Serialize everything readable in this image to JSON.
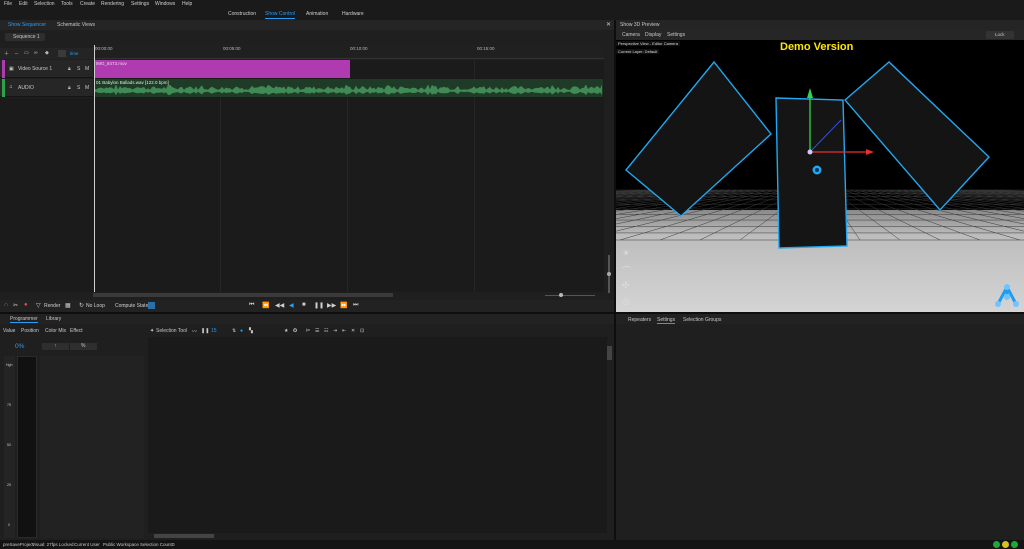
{
  "menu": [
    "File",
    "Edit",
    "Selection",
    "Tools",
    "Create",
    "Rendering",
    "Settings",
    "Windows",
    "Help"
  ],
  "workspace_tabs": [
    "Construction",
    "Show Control",
    "Animation",
    "Hardware"
  ],
  "sequencer": {
    "tabs": [
      "Show Sequencer",
      "Schematic Views"
    ],
    "sequence_tab": "Sequence 1",
    "time_mode": "time",
    "ruler": [
      "00:00:00",
      "00:05:00",
      "00:10:00",
      "00:15:00"
    ],
    "tracks": [
      {
        "name": "Video Source 1",
        "flags": [
          "L",
          "S",
          "M"
        ],
        "color": "#b03ab0",
        "clip": "IMG_8473.mov"
      },
      {
        "name": "AUDIO",
        "flags": [
          "L",
          "S",
          "M"
        ],
        "color": "#2fa14a",
        "clip": "01 Babylon Ballads.wav [122.0 bpm]"
      }
    ]
  },
  "transport": {
    "render": "Render",
    "loop": "No Loop",
    "compute": "Compute State"
  },
  "programmer": {
    "tabs": [
      "Programmer",
      "Library"
    ],
    "subtabs": [
      "Value",
      "Position",
      "Color Mix",
      "Effect"
    ],
    "percent": "0%",
    "btn_a": "↑",
    "btn_b": "%",
    "selection_tool": "Selection Tool",
    "fixture_count": "15",
    "fader_ticks": [
      "Hgh",
      "75",
      "50",
      "25",
      "0"
    ]
  },
  "preview": {
    "title": "Show 3D Preview",
    "menu": [
      "Camera",
      "Display",
      "Settings"
    ],
    "lock": "Lock",
    "view_info": [
      "Perspective View - Editor Camera",
      "Current Layer: Default"
    ],
    "watermark": "Demo Version",
    "watermark_color": "#ffe600"
  },
  "right_bottom": {
    "tabs": [
      "Repeaters",
      "Settings",
      "Selection Groups"
    ]
  },
  "status": {
    "project": "preSaveProject",
    "visual": "Visual: 27fps Locked",
    "user": "Current User",
    "workspace": "Public Workspace",
    "selection": "Selection Count:",
    "selection_count": "0"
  },
  "colors": {
    "accent": "#2a9df4",
    "video": "#b03ab0",
    "audio": "#2fa14a",
    "outline": "#22a7f0"
  }
}
